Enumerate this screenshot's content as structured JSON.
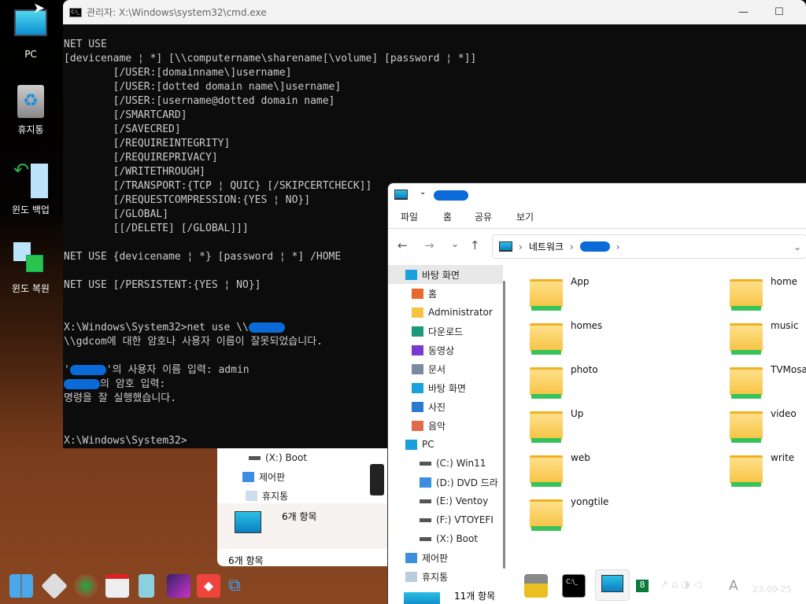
{
  "desktop": {
    "icons": [
      {
        "label": "PC",
        "icon": "pc-icon"
      },
      {
        "label": "휴지통",
        "icon": "recycle-bin-icon"
      },
      {
        "label": "윈도 백업",
        "icon": "backup-icon"
      },
      {
        "label": "윈도 복원",
        "icon": "restore-icon"
      }
    ]
  },
  "cmd": {
    "title": "관리자: X:\\Windows\\system32\\cmd.exe",
    "icon_label": "C:\\_",
    "lines": [
      {
        "pre": "NET USE"
      },
      {
        "pre": "[devicename ¦ *] [\\\\computername\\sharename[\\volume] [password ¦ *]]"
      },
      {
        "pre": "        [/USER:[domainname\\]username]"
      },
      {
        "pre": "        [/USER:[dotted domain name\\]username]"
      },
      {
        "pre": "        [/USER:[username@dotted domain name]"
      },
      {
        "pre": "        [/SMARTCARD]"
      },
      {
        "pre": "        [/SAVECRED]"
      },
      {
        "pre": "        [/REQUIREINTEGRITY]"
      },
      {
        "pre": "        [/REQUIREPRIVACY]"
      },
      {
        "pre": "        [/WRITETHROUGH]"
      },
      {
        "pre": "        [/TRANSPORT:{TCP ¦ QUIC} [/SKIPCERTCHECK]]"
      },
      {
        "pre": "        [/REQUESTCOMPRESSION:{YES ¦ NO}]"
      },
      {
        "pre": "        [/GLOBAL]"
      },
      {
        "pre": "        [[/DELETE] [/GLOBAL]]]"
      },
      {
        "pre": ""
      },
      {
        "pre": "NET USE {devicename ¦ *} [password ¦ *] /HOME"
      },
      {
        "pre": ""
      },
      {
        "pre": "NET USE [/PERSISTENT:{YES ¦ NO}]"
      },
      {
        "pre": ""
      },
      {
        "pre": ""
      },
      {
        "pre": "X:\\Windows\\System32>net use \\\\",
        "redacted": true,
        "post": ""
      },
      {
        "pre": "\\\\gdcom에 대한 암호나 사용자 이름이 잘못되었습니다."
      },
      {
        "pre": ""
      },
      {
        "pre": "'",
        "redacted": true,
        "post": "'의 사용자 이름 입력: admin"
      },
      {
        "pre": "",
        "redacted": true,
        "post": "의 암호 입력:"
      },
      {
        "pre": "명령을 잘 실행했습니다."
      },
      {
        "pre": ""
      },
      {
        "pre": ""
      },
      {
        "pre": "X:\\Windows\\System32>"
      }
    ]
  },
  "bg_explorer": {
    "items": [
      "(X:) Boot",
      "제어판",
      "휴지통"
    ],
    "detail_count": "6개 항목",
    "status": "6개 항목"
  },
  "explorer": {
    "menu": [
      "파일",
      "홈",
      "공유",
      "보기"
    ],
    "breadcrumb": [
      "네트워크"
    ],
    "sidebar": [
      {
        "label": "바탕 화면",
        "icon": "desktop-icon",
        "selected": true
      },
      {
        "label": "홈",
        "icon": "home-icon"
      },
      {
        "label": "Administrator",
        "icon": "folder-icon"
      },
      {
        "label": "다운로드",
        "icon": "download-icon"
      },
      {
        "label": "동영상",
        "icon": "video-icon"
      },
      {
        "label": "문서",
        "icon": "document-icon"
      },
      {
        "label": "바탕 화면",
        "icon": "desktop-icon"
      },
      {
        "label": "사진",
        "icon": "picture-icon"
      },
      {
        "label": "음악",
        "icon": "music-icon"
      },
      {
        "label": "PC",
        "icon": "pc-icon"
      },
      {
        "label": "(C:) Win11",
        "icon": "drive-icon"
      },
      {
        "label": "(D:) DVD 드라",
        "icon": "dvd-icon"
      },
      {
        "label": "(E:) Ventoy",
        "icon": "drive-icon"
      },
      {
        "label": "(F:) VTOYEFI",
        "icon": "drive-icon"
      },
      {
        "label": "(X:) Boot",
        "icon": "drive-icon"
      },
      {
        "label": "제어판",
        "icon": "control-panel-icon"
      },
      {
        "label": "휴지통",
        "icon": "recycle-bin-icon"
      }
    ],
    "folders": [
      "App",
      "home",
      "homes",
      "music",
      "photo",
      "TVMosai",
      "Up",
      "video",
      "web",
      "write",
      "yongtile"
    ],
    "status": "11개 항목"
  },
  "taskbar": {
    "badge": "8",
    "ime": "A",
    "date": "23-09-25"
  }
}
